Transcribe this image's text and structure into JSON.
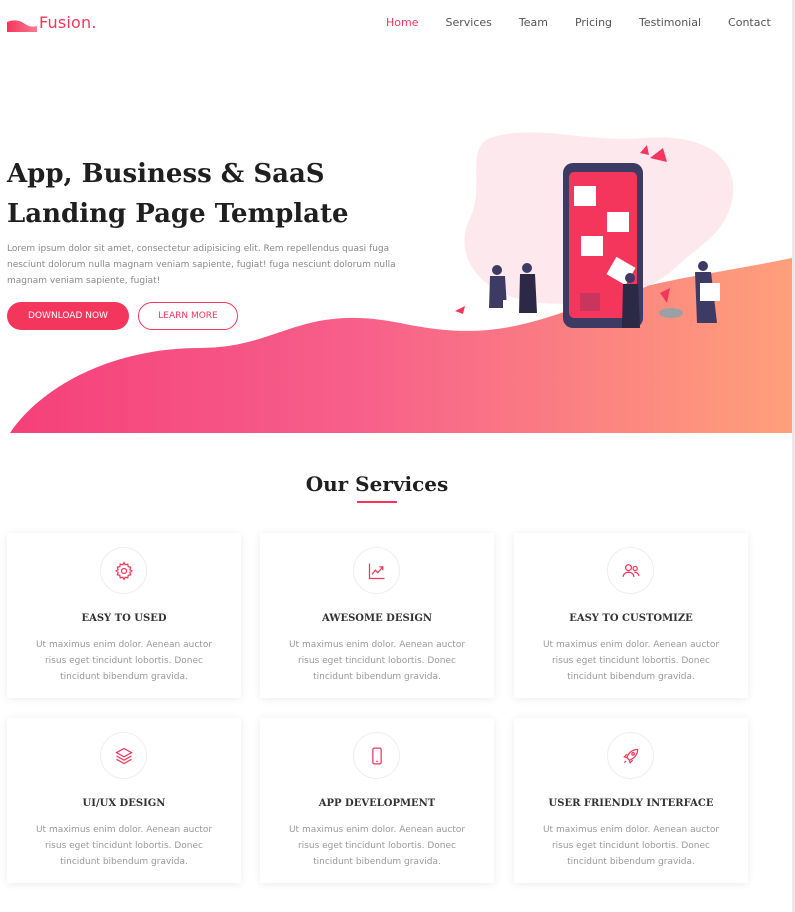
{
  "brand": {
    "name": "Fusion.",
    "color": "#f5365c"
  },
  "nav": {
    "items": [
      {
        "label": "Home",
        "active": true
      },
      {
        "label": "Services",
        "active": false
      },
      {
        "label": "Team",
        "active": false
      },
      {
        "label": "Pricing",
        "active": false
      },
      {
        "label": "Testimonial",
        "active": false
      },
      {
        "label": "Contact",
        "active": false
      }
    ]
  },
  "hero": {
    "title_line1": "App, Business & SaaS",
    "title_line2": "Landing Page Template",
    "text": "Lorem ipsum dolor sit amet, consectetur adipisicing elit. Rem repellendus quasi fuga nesciunt dolorum nulla magnam veniam sapiente, fugiat! fuga nesciunt dolorum nulla magnam veniam sapiente, fugiat!",
    "primary_button": "DOWNLOAD NOW",
    "secondary_button": "LEARN MORE"
  },
  "services": {
    "title": "Our Services",
    "items": [
      {
        "icon": "gear-icon",
        "title": "EASY TO USED",
        "text": "Ut maximus enim dolor. Aenean auctor risus eget tincidunt lobortis. Donec tincidunt bibendum gravida."
      },
      {
        "icon": "chart-icon",
        "title": "AWESOME DESIGN",
        "text": "Ut maximus enim dolor. Aenean auctor risus eget tincidunt lobortis. Donec tincidunt bibendum gravida."
      },
      {
        "icon": "users-icon",
        "title": "EASY TO CUSTOMIZE",
        "text": "Ut maximus enim dolor. Aenean auctor risus eget tincidunt lobortis. Donec tincidunt bibendum gravida."
      },
      {
        "icon": "layers-icon",
        "title": "UI/UX DESIGN",
        "text": "Ut maximus enim dolor. Aenean auctor risus eget tincidunt lobortis. Donec tincidunt bibendum gravida."
      },
      {
        "icon": "mobile-icon",
        "title": "APP DEVELOPMENT",
        "text": "Ut maximus enim dolor. Aenean auctor risus eget tincidunt lobortis. Donec tincidunt bibendum gravida."
      },
      {
        "icon": "rocket-icon",
        "title": "USER FRIENDLY INTERFACE",
        "text": "Ut maximus enim dolor. Aenean auctor risus eget tincidunt lobortis. Donec tincidunt bibendum gravida."
      }
    ]
  }
}
